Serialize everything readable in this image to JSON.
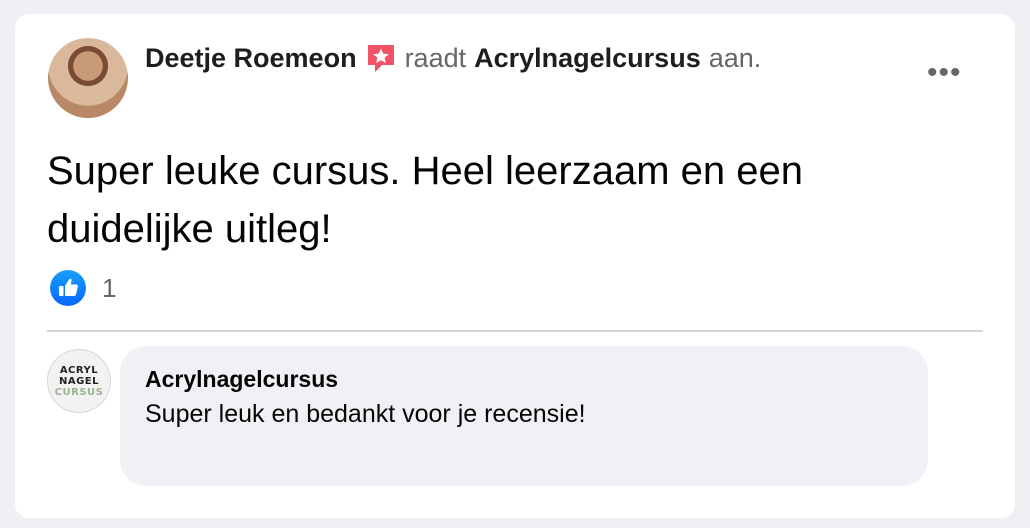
{
  "post": {
    "author": "Deetje Roemeon",
    "verb": "raadt",
    "page": "Acrylnagelcursus",
    "suffix": "aan.",
    "more_label": "•••",
    "text": "Super leuke cursus. Heel leerzaam en een duidelijke uitleg!",
    "reaction_count": "1",
    "icons": {
      "recommend": "recommend-star-icon",
      "reaction": "like-icon",
      "menu": "more-options-icon"
    },
    "colors": {
      "recommend": "#f25268",
      "like": "#1877f2",
      "muted": "#65676b"
    }
  },
  "reply": {
    "author": "Acrylnagelcursus",
    "text": "Super leuk en bedankt voor je recensie!",
    "logo_lines": [
      "ACRYL",
      "NAGEL",
      "CURSUS"
    ]
  }
}
